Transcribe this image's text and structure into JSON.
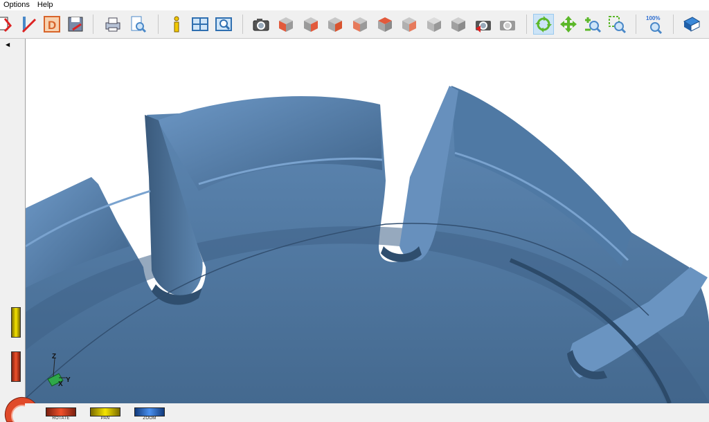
{
  "menu": {
    "options": "Options",
    "help": "Help"
  },
  "toolbar": {
    "buttons": [
      {
        "icon": "open-icon"
      },
      {
        "icon": "line-tool-icon"
      },
      {
        "icon": "dimension-d-icon"
      },
      {
        "icon": "save-icon"
      },
      {
        "icon": "print-icon"
      },
      {
        "icon": "print-preview-icon"
      },
      {
        "icon": "info-icon"
      },
      {
        "icon": "grid-view-icon"
      },
      {
        "icon": "zoom-window-icon"
      },
      {
        "icon": "camera-icon"
      },
      {
        "icon": "view-front-icon"
      },
      {
        "icon": "view-back-icon"
      },
      {
        "icon": "view-right-icon"
      },
      {
        "icon": "view-left-icon"
      },
      {
        "icon": "view-top-icon"
      },
      {
        "icon": "view-bottom-icon"
      },
      {
        "icon": "view-iso-icon"
      },
      {
        "icon": "view-iso-alt-icon"
      },
      {
        "icon": "camera-restore-icon"
      },
      {
        "icon": "camera-gray-icon"
      },
      {
        "icon": "rotate-mode-icon"
      },
      {
        "icon": "pan-mode-icon"
      },
      {
        "icon": "zoom-in-icon"
      },
      {
        "icon": "zoom-box-icon"
      },
      {
        "icon": "zoom-100-icon"
      },
      {
        "icon": "help-book-icon"
      }
    ],
    "zoom_label": "100%"
  },
  "axes": {
    "x": "X",
    "y": "Y",
    "z": "Z"
  },
  "modes": {
    "rotate": "ROTATE",
    "pan": "PAN",
    "zoom": "ZOOM"
  },
  "colors": {
    "part": "#4a7199",
    "part_light": "#6b95c2",
    "part_dark": "#2f4e6e",
    "rotate": "#e04a2a",
    "pan": "#e8d21c",
    "zoom": "#2f6fd0"
  }
}
